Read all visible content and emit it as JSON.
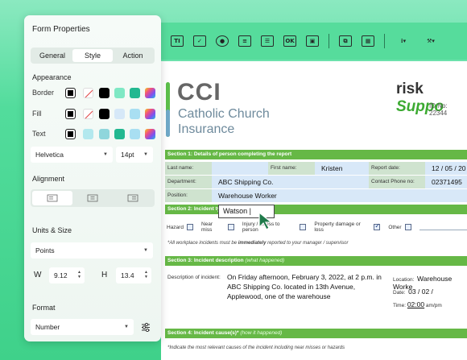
{
  "panel": {
    "title": "Form Properties",
    "tabs": [
      "General",
      "Style",
      "Action"
    ],
    "active_tab": "Style",
    "appearance": {
      "heading": "Appearance",
      "rows": [
        {
          "label": "Border",
          "swatches": [
            "#ffffff",
            "none",
            "#000000",
            "#7fe8c4",
            "#22b890",
            "rainbow"
          ]
        },
        {
          "label": "Fill",
          "swatches": [
            "#ffffff",
            "none",
            "#000000",
            "#d6e8f8",
            "#a9dff2",
            "rainbow"
          ]
        },
        {
          "label": "Text",
          "swatches": [
            "#000000",
            "#b3e8ee",
            "#8fd6dc",
            "#22b890",
            "#a9dff2",
            "rainbow"
          ]
        }
      ],
      "font": "Helvetica",
      "size": "14pt"
    },
    "alignment": {
      "heading": "Alignment"
    },
    "units": {
      "heading": "Units & Size",
      "unit": "Points",
      "w_label": "W",
      "w_value": "9.12",
      "h_label": "H",
      "h_value": "13.4"
    },
    "format": {
      "heading": "Format",
      "value": "Number"
    }
  },
  "doc": {
    "cci": "CCI",
    "org_line1": "Catholic Church",
    "org_line2": "Insurance",
    "logo_a": "risk",
    "logo_b": "Suppo",
    "id_no": "ID No: 22344",
    "section1": "Section 1: Details of person completing the report",
    "last_name_lbl": "Last name:",
    "first_name_lbl": "First name:",
    "first_name_val": "Kristen",
    "report_date_lbl": "Report date:",
    "report_date_val": "12  /  05  /  20",
    "department_lbl": "Department:",
    "department_val": "ABC Shipping Co.",
    "contact_lbl": "Contact Phone no:",
    "contact_val": "02371495",
    "position_lbl": "Position:",
    "position_val": "Warehouse Worker",
    "section2": "Section 2: Incident typ",
    "popup_value": "Watson |",
    "checks": [
      {
        "label": "Hazard",
        "checked": false
      },
      {
        "label": "Near miss",
        "checked": false
      },
      {
        "label": "Injury / illness to person",
        "checked": false
      },
      {
        "label": "Property damage or loss",
        "checked": true
      },
      {
        "label": "Other",
        "checked": false
      }
    ],
    "note1_a": "*All workplace incidents must be ",
    "note1_b": "immediately",
    "note1_c": " reported to your manager / supervisor",
    "section3": "Section 3: Incident description",
    "section3_sub": "(what happened)",
    "desc_lbl": "Description of incident:",
    "desc_val": "On Friday afternoon, February 3, 2022, at 2 p.m. in ABC Shipping Co. located in 13th Avenue, Applewood, one of the warehouse",
    "location_lbl": "Location:",
    "location_val": "Warehouse Worke",
    "date_lbl": "Date:",
    "date_val": "03  /  02  /",
    "time_lbl": "Time:",
    "time_val": "02:00",
    "time_unit": "am/pm",
    "section4": "Section 4: Incident cause(s)*",
    "section4_sub": "(how it happened)",
    "note2": "*Indicate the most relevant causes of the incident including near misses or hazards"
  }
}
